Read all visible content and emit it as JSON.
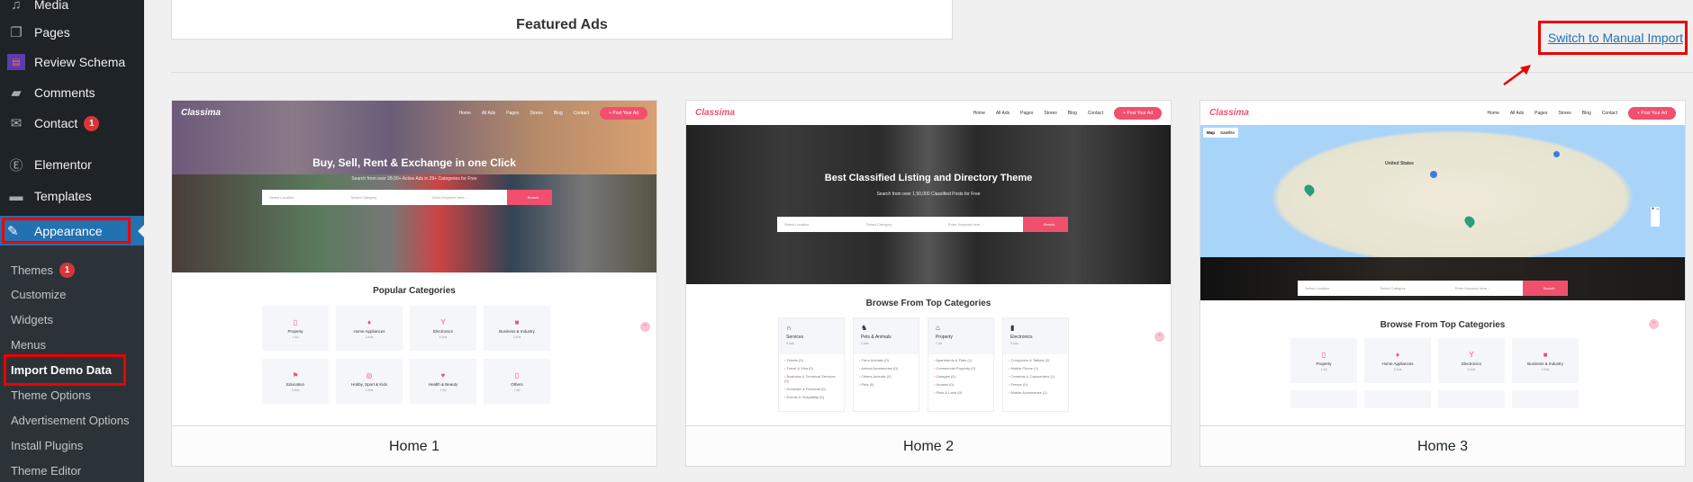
{
  "sidebar": {
    "items": [
      {
        "label": "Media",
        "icon": "media-icon"
      },
      {
        "label": "Pages",
        "icon": "pages-icon"
      },
      {
        "label": "Review Schema",
        "icon": "review-schema-icon"
      },
      {
        "label": "Comments",
        "icon": "comments-icon"
      },
      {
        "label": "Contact",
        "icon": "mail-icon",
        "badge": "1"
      },
      {
        "label": "Elementor",
        "icon": "elementor-icon"
      },
      {
        "label": "Templates",
        "icon": "folder-icon"
      }
    ],
    "appearance": "Appearance",
    "submenu": [
      {
        "label": "Themes",
        "badge": "1"
      },
      {
        "label": "Customize"
      },
      {
        "label": "Widgets"
      },
      {
        "label": "Menus"
      },
      {
        "label": "Import Demo Data",
        "current": true
      },
      {
        "label": "Theme Options"
      },
      {
        "label": "Advertisement Options"
      },
      {
        "label": "Install Plugins"
      },
      {
        "label": "Theme Editor"
      }
    ]
  },
  "featured_label": "Featured Ads",
  "switch_link": "Switch to Manual Import",
  "colors": {
    "accent": "#f0506e",
    "wp_blue": "#2271b1",
    "highlight": "#ee0000"
  },
  "demo": {
    "logo": "Classima",
    "nav": [
      "Home",
      "All Ads",
      "Pages",
      "Stores",
      "Blog",
      "Contact"
    ],
    "post_button": "+ Post Your Ad",
    "search": {
      "location": "Select Location",
      "category": "Select Category",
      "keyword": "Enter Keyword here ...",
      "button": "Search"
    }
  },
  "cards": [
    {
      "label": "Home 1",
      "hero_title": "Buy, Sell, Rent & Exchange in one Click",
      "hero_sub": "Search from over 28,00+ Active Ads in 29+ Categories for Free",
      "section": "Popular Categories",
      "categories": [
        {
          "name": "Property",
          "count": "1 Ad",
          "icon": "▯"
        },
        {
          "name": "Home Appliances",
          "count": "3 Ads",
          "icon": "♦"
        },
        {
          "name": "Electronics",
          "count": "5 Ads",
          "icon": "Y"
        },
        {
          "name": "Business & Industry",
          "count": "3 Ads",
          "icon": "■"
        },
        {
          "name": "Education",
          "count": "3 Ads",
          "icon": "⚑"
        },
        {
          "name": "Hobby, Sport & Kids",
          "count": "4 Ads",
          "icon": "◎"
        },
        {
          "name": "Health & Beauty",
          "count": "1 Ad",
          "icon": "♥"
        },
        {
          "name": "Others",
          "count": "1 Ad",
          "icon": "▯"
        }
      ]
    },
    {
      "label": "Home 2",
      "hero_title": "Best Classified Listing and Directory Theme",
      "hero_sub": "Search from over 1,50,000 Classified Posts for Free",
      "section": "Browse From Top Categories",
      "categories": [
        {
          "name": "Services",
          "count": "5 Ads",
          "icon": "∩",
          "subs": [
            "Tickets (0)",
            "Travel & Visa (0)",
            "Business & Technical Services (0)",
            "Domestic & Personal (0)",
            "Events & Hospitality (0)"
          ]
        },
        {
          "name": "Pets & Animals",
          "count": "0 Ads",
          "icon": "♞",
          "subs": [
            "Farm Animals (0)",
            "Animal Accessories (0)",
            "Others Animals (0)",
            "Pets (0)"
          ]
        },
        {
          "name": "Property",
          "count": "1 Ad",
          "icon": "⌂",
          "subs": [
            "Apartments & Flats (1)",
            "Commercial Property (0)",
            "Garages (0)",
            "Houses (0)",
            "Plots & Land (0)"
          ]
        },
        {
          "name": "Electronics",
          "count": "5 Ads",
          "icon": "▮",
          "subs": [
            "Computers & Tablets (2)",
            "Mobile Phone (1)",
            "Cameras & Camcorders (1)",
            "Freeze (0)",
            "Mobile Accessories (1)"
          ]
        }
      ]
    },
    {
      "label": "Home 3",
      "map": {
        "tab_map": "Map",
        "tab_satellite": "Satellite",
        "country": "United States"
      },
      "section": "Browse From Top Categories",
      "categories": [
        {
          "name": "Property",
          "count": "1 Ad",
          "icon": "▯"
        },
        {
          "name": "Home Appliances",
          "count": "3 Ads",
          "icon": "♦"
        },
        {
          "name": "Electronics",
          "count": "5 Ads",
          "icon": "Y"
        },
        {
          "name": "Business & Industry",
          "count": "3 Ads",
          "icon": "■"
        }
      ]
    }
  ]
}
